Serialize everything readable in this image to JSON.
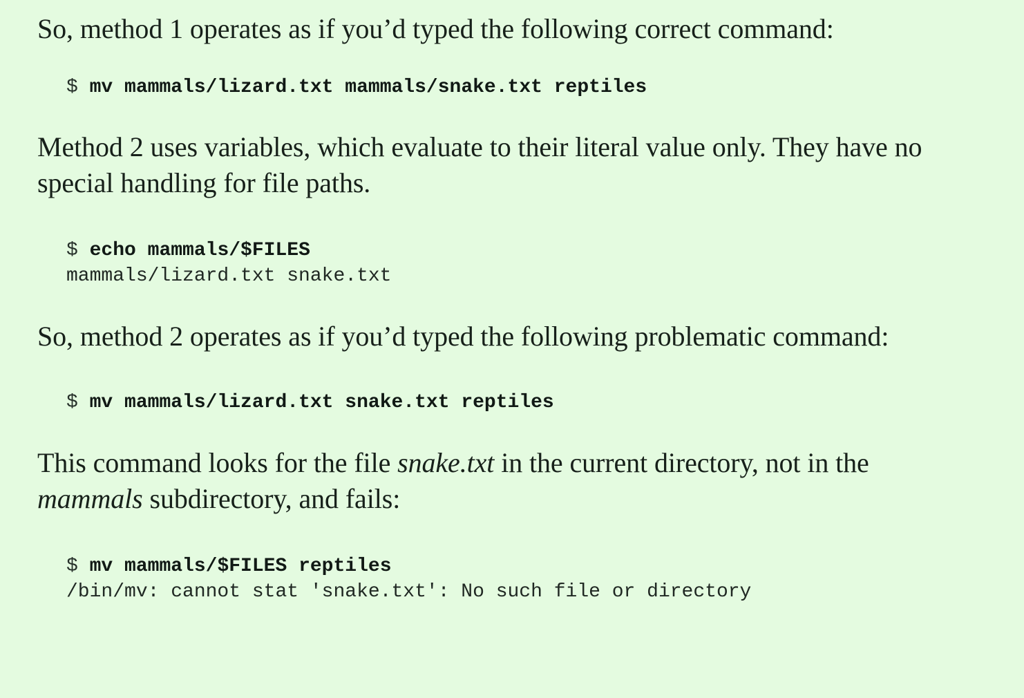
{
  "paragraphs": {
    "p1": "So, method 1 operates as if you’d typed the following correct command:",
    "p2": "Method 2 uses variables, which evaluate to their literal value only. They have no special handling for file paths.",
    "p3": "So, method 2 operates as if you’d typed the following problematic command:",
    "p4": {
      "t1": "This command looks for the file ",
      "em1": "snake.txt",
      "t2": " in the current directory, not in the ",
      "em2": "mammals",
      "t3": " subdirectory, and fails:"
    }
  },
  "code": {
    "prompt": "$",
    "block1": {
      "command": "mv mammals/lizard.txt mammals/snake.txt reptiles"
    },
    "block2": {
      "command": "echo mammals/$FILES",
      "output": "mammals/lizard.txt snake.txt"
    },
    "block3": {
      "command": "mv mammals/lizard.txt snake.txt reptiles"
    },
    "block4": {
      "command": "mv mammals/$FILES reptiles",
      "output": "/bin/mv: cannot stat 'snake.txt': No such file or directory"
    }
  },
  "colors": {
    "background": "#e4fbe0",
    "text": "#17201a"
  }
}
